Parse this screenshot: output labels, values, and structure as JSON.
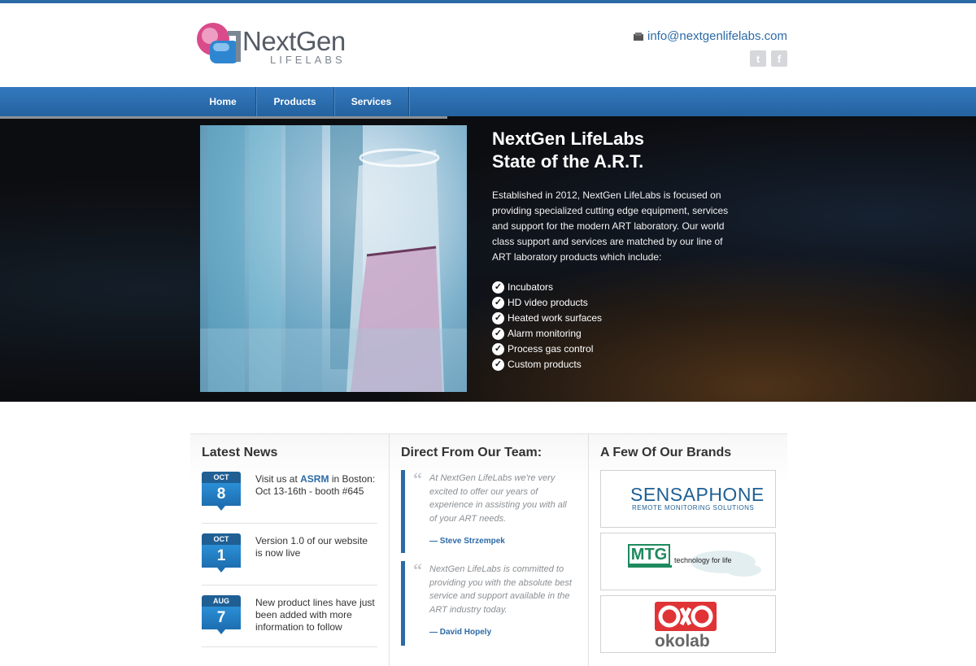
{
  "header": {
    "logo_name": "NextGen",
    "logo_sub": "LIFELABS",
    "email": "info@nextgenlifelabs.com",
    "social": [
      {
        "icon": "twitter-icon",
        "glyph": "t"
      },
      {
        "icon": "facebook-icon",
        "glyph": "f"
      }
    ]
  },
  "nav": {
    "items": [
      {
        "label": "Home"
      },
      {
        "label": "Products"
      },
      {
        "label": "Services"
      }
    ]
  },
  "hero": {
    "title_line1": "NextGen LifeLabs",
    "title_line2": "State of the A.R.T.",
    "description": "Established in 2012, NextGen LifeLabs is focused on providing specialized cutting edge equipment, services and support for the modern ART laboratory. Our world class support and services are matched by our line of ART laboratory products which include:",
    "products": [
      "Incubators",
      "HD video products",
      "Heated work surfaces",
      "Alarm monitoring",
      "Process gas control",
      "Custom products"
    ]
  },
  "news": {
    "title": "Latest News",
    "items": [
      {
        "month": "OCT",
        "day": "8",
        "text_before": "Visit us at ",
        "link": "ASRM",
        "text_after": " in Boston: Oct 13-16th - booth #645"
      },
      {
        "month": "OCT",
        "day": "1",
        "text_before": "Version 1.0 of our website is now live",
        "link": "",
        "text_after": ""
      },
      {
        "month": "AUG",
        "day": "7",
        "text_before": "New product lines have just been added with more information to follow",
        "link": "",
        "text_after": ""
      }
    ]
  },
  "team": {
    "title": "Direct From Our Team:",
    "quotes": [
      {
        "text": "At NextGen LifeLabs we're very excited to offer our years of experience in assisting you with all of your ART needs.",
        "author": "— Steve Strzempek"
      },
      {
        "text": "NextGen LifeLabs is committed to providing you with the absolute best service and support available in the ART industry today.",
        "author": "— David Hopely"
      }
    ]
  },
  "brands": {
    "title": "A Few Of Our Brands",
    "sensaphone": {
      "name": "SENSAPHONE",
      "sub": "REMOTE MONITORING SOLUTIONS"
    },
    "mtg": {
      "name": "MTG",
      "tagline": "technology for life"
    },
    "okolab": {
      "name": "okolab"
    }
  }
}
